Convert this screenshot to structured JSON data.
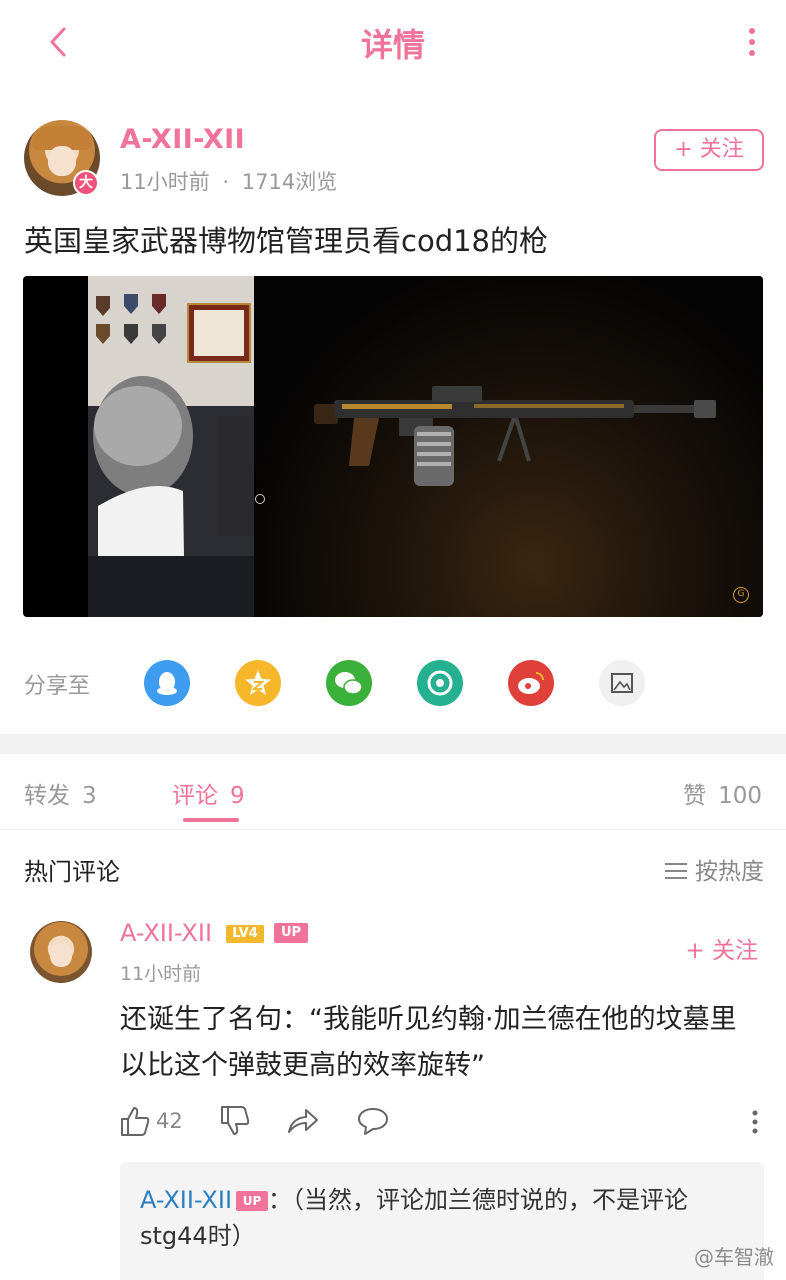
{
  "header": {
    "title": "详情"
  },
  "post": {
    "author": "A-XII-XII",
    "author_badge": "大",
    "time": "11小时前",
    "dot": "·",
    "views": "1714浏览",
    "follow_label": "+ 关注",
    "title": "英国皇家武器博物馆管理员看cod18的枪"
  },
  "share": {
    "label": "分享至",
    "targets": [
      "qq-icon",
      "qzone-icon",
      "wechat-icon",
      "moments-icon",
      "weibo-icon",
      "image-save-icon"
    ]
  },
  "tabs": [
    {
      "label": "转发",
      "count": "3"
    },
    {
      "label": "评论",
      "count": "9"
    },
    {
      "label": "赞",
      "count": "100"
    }
  ],
  "hot": {
    "title": "热门评论",
    "sort_label": "按热度"
  },
  "comment": {
    "name": "A-XII-XII",
    "level": "LV4",
    "up_badge": "UP",
    "time": "11小时前",
    "follow_label": "+ 关注",
    "text": "还诞生了名句：“我能听见约翰·加兰德在他的坟墓里以比这个弹鼓更高的效率旋转”",
    "likes": "42"
  },
  "reply": {
    "name": "A-XII-XII",
    "up_badge": "UP",
    "text": "：（当然，评论加兰德时说的，不是评论stg44时）"
  },
  "watermark": "@车智澈",
  "colors": {
    "accent": "#f0739a",
    "reply_name": "#2a7fc1",
    "level_badge": "#f2b92e"
  }
}
